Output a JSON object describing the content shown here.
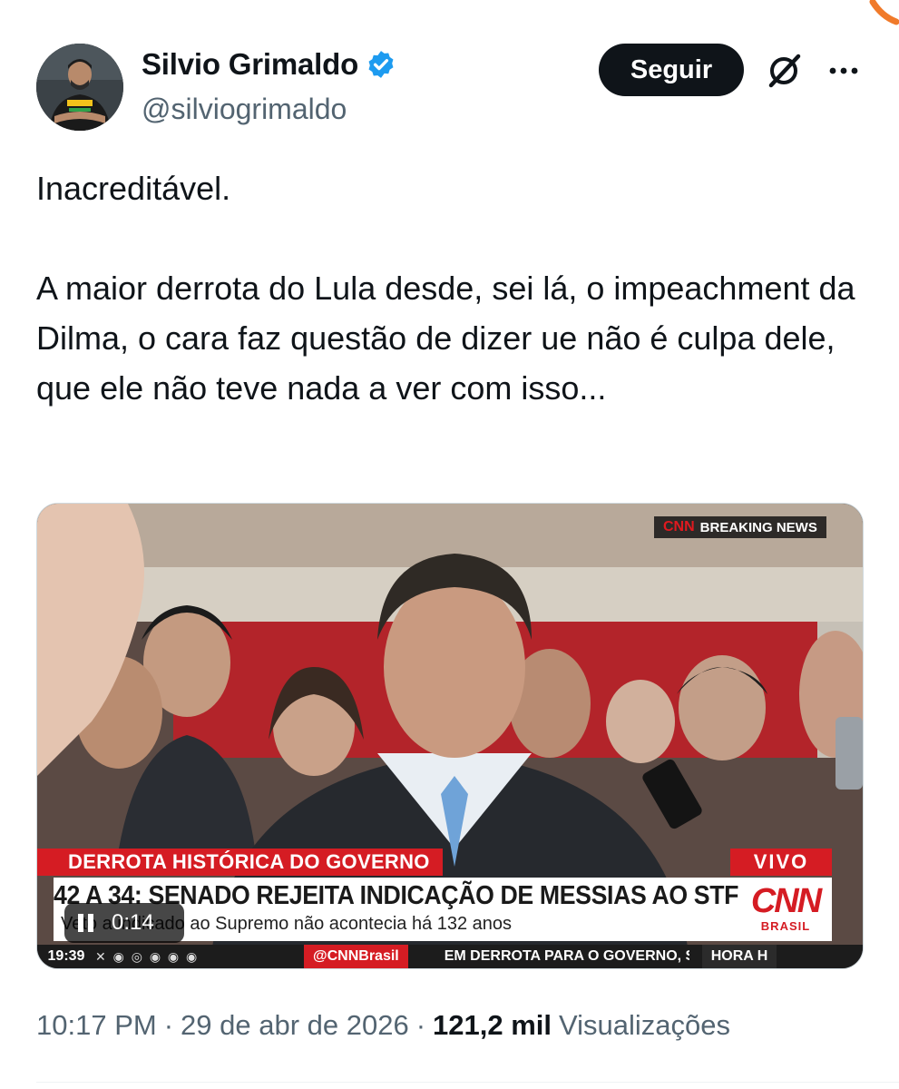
{
  "author": {
    "name": "Silvio Grimaldo",
    "handle": "@silviogrimaldo",
    "verified": true
  },
  "actions": {
    "follow_label": "Seguir"
  },
  "tweet": {
    "paragraphs": [
      "Inacreditável.",
      "A maior derrota do Lula desde, sei lá, o impeachment da Dilma, o cara faz questão de dizer ue não é culpa dele, que ele não teve nada a ver com isso..."
    ]
  },
  "video": {
    "duration": "0:14",
    "breaking_brand": "CNN",
    "breaking_label": "BREAKING NEWS",
    "lower_third_title": "DERROTA HISTÓRICA DO GOVERNO",
    "live_label": "VIVO",
    "headline": "42 A 34: SENADO REJEITA INDICAÇÃO DE MESSIAS AO STF",
    "subline": "Veto a indicado ao Supremo não acontecia há 132 anos",
    "logo_text": "CNN",
    "logo_sub": "BRASIL",
    "ticker_time": "19:39",
    "ticker_handle": "@CNNBrasil",
    "ticker_text": "EM DERROTA PARA O GOVERNO, S",
    "ticker_segment": "HORA H"
  },
  "meta": {
    "time": "10:17 PM",
    "separator": "·",
    "date": "29 de abr de 2026",
    "views_count": "121,2 mil",
    "views_label": "Visualizações"
  },
  "colors": {
    "accent_blue": "#1d9bf0",
    "text_primary": "#0f1419",
    "text_secondary": "#536471",
    "cnn_red": "#d51c23"
  },
  "icons": [
    "verified-badge-icon",
    "grok-icon",
    "more-options-icon",
    "pause-icon"
  ]
}
